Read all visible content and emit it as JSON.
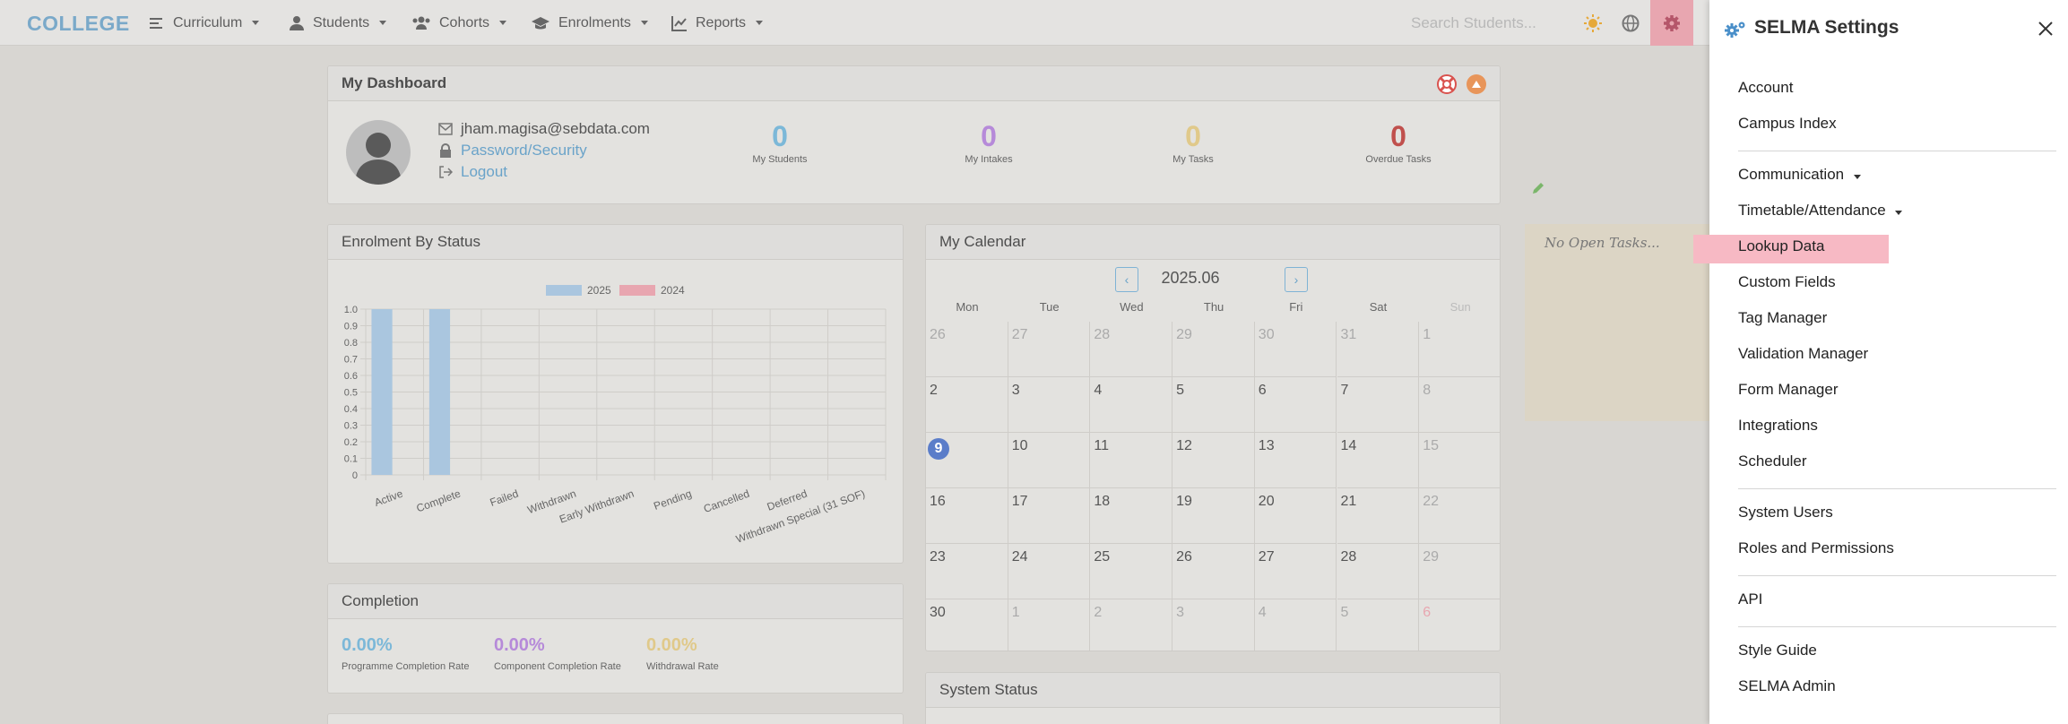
{
  "brand": "COLLEGE",
  "nav": {
    "items": [
      "Curriculum",
      "Students",
      "Cohorts",
      "Enrolments",
      "Reports"
    ],
    "search_placeholder": "Search Students..."
  },
  "dashboard": {
    "title": "My Dashboard",
    "email": "jham.magisa@sebdata.com",
    "password_link": "Password/Security",
    "logout_link": "Logout",
    "stats": [
      {
        "value": "0",
        "label": "My Students",
        "color": "#7cb8d8"
      },
      {
        "value": "0",
        "label": "My Intakes",
        "color": "#b68ad9"
      },
      {
        "value": "0",
        "label": "My Tasks",
        "color": "#e0c98a"
      },
      {
        "value": "0",
        "label": "Overdue Tasks",
        "color": "#c0504d"
      }
    ]
  },
  "enrolment": {
    "title": "Enrolment By Status"
  },
  "chart_data": {
    "type": "bar",
    "title": "",
    "categories": [
      "Active",
      "Complete",
      "Failed",
      "Withdrawn",
      "Early Withdrawn",
      "Pending",
      "Cancelled",
      "Deferred",
      "Withdrawn Special (31 SOF)"
    ],
    "series": [
      {
        "name": "2025",
        "values": [
          1,
          1,
          0,
          0,
          0,
          0,
          0,
          0,
          0
        ],
        "color": "#aac6df"
      },
      {
        "name": "2024",
        "values": [
          0,
          0,
          0,
          0,
          0,
          0,
          0,
          0,
          0
        ],
        "color": "#e8a6b0"
      }
    ],
    "yticks": [
      "0",
      "0.1",
      "0.2",
      "0.3",
      "0.4",
      "0.5",
      "0.6",
      "0.7",
      "0.8",
      "0.9",
      "1.0"
    ],
    "ylim": [
      0,
      1
    ],
    "legend": "top-center",
    "grid": true
  },
  "calendar": {
    "title": "My Calendar",
    "month": "2025.06",
    "days": [
      "Mon",
      "Tue",
      "Wed",
      "Thu",
      "Fri",
      "Sat",
      "Sun"
    ],
    "weeks": [
      [
        "26",
        "27",
        "28",
        "29",
        "30",
        "31",
        "1"
      ],
      [
        "2",
        "3",
        "4",
        "5",
        "6",
        "7",
        "8"
      ],
      [
        "9",
        "10",
        "11",
        "12",
        "13",
        "14",
        "15"
      ],
      [
        "16",
        "17",
        "18",
        "19",
        "20",
        "21",
        "22"
      ],
      [
        "23",
        "24",
        "25",
        "26",
        "27",
        "28",
        "29"
      ],
      [
        "30",
        "1",
        "2",
        "3",
        "4",
        "5",
        "6"
      ]
    ],
    "today": "9"
  },
  "completion": {
    "title": "Completion",
    "items": [
      {
        "value": "0.00%",
        "label": "Programme Completion Rate",
        "color": "#7cb8d8"
      },
      {
        "value": "0.00%",
        "label": "Component Completion Rate",
        "color": "#b68ad9"
      },
      {
        "value": "0.00%",
        "label": "Withdrawal Rate",
        "color": "#e0c98a"
      }
    ]
  },
  "system_status": {
    "title": "System Status"
  },
  "tasks": {
    "empty_text": "No Open Tasks..."
  },
  "settings": {
    "title": "SELMA Settings",
    "items": [
      "Account",
      "Campus Index",
      "Communication",
      "Timetable/Attendance",
      "Lookup Data",
      "Custom Fields",
      "Tag Manager",
      "Validation Manager",
      "Form Manager",
      "Integrations",
      "Scheduler",
      "System Users",
      "Roles and Permissions",
      "API",
      "Style Guide",
      "SELMA Admin"
    ]
  }
}
